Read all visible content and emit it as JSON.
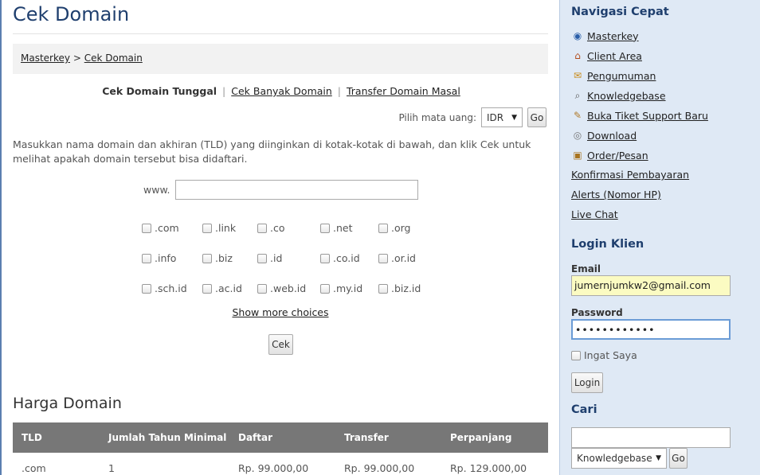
{
  "main": {
    "title": "Cek Domain",
    "breadcrumb": {
      "home": "Masterkey",
      "sep": ">",
      "current": "Cek Domain"
    },
    "modes": {
      "single": "Cek Domain Tunggal",
      "bulk": "Cek Banyak Domain",
      "transfer": "Transfer Domain Masal",
      "sep": "|"
    },
    "currency": {
      "label": "Pilih mata uang:",
      "value": "IDR",
      "go": "Go"
    },
    "intro": "Masukkan nama domain dan akhiran (TLD) yang diinginkan di kotak-kotak di bawah, dan klik Cek untuk melihat apakah domain tersebut bisa didaftari.",
    "www_label": "www.",
    "tlds": [
      ".com",
      ".link",
      ".co",
      ".net",
      ".org",
      ".info",
      ".biz",
      ".id",
      ".co.id",
      ".or.id",
      ".sch.id",
      ".ac.id",
      ".web.id",
      ".my.id",
      ".biz.id"
    ],
    "show_more": "Show more choices",
    "cek_button": "Cek",
    "pricing": {
      "title": "Harga Domain",
      "headers": [
        "TLD",
        "Jumlah Tahun Minimal",
        "Daftar",
        "Transfer",
        "Perpanjang"
      ],
      "rows": [
        [
          ".com",
          "1",
          "Rp. 99.000,00",
          "Rp. 99.000,00",
          "Rp. 129.000,00"
        ]
      ]
    }
  },
  "sidebar": {
    "nav_title": "Navigasi Cepat",
    "nav_items": [
      {
        "label": "Masterkey",
        "icon": "globe-icon",
        "glyph": "◉",
        "color": "#2a5ea8"
      },
      {
        "label": "Client Area",
        "icon": "home-icon",
        "glyph": "⌂",
        "color": "#b24a1a"
      },
      {
        "label": "Pengumuman",
        "icon": "announcement-icon",
        "glyph": "✉",
        "color": "#c98a17"
      },
      {
        "label": "Knowledgebase",
        "icon": "magnifier-icon",
        "glyph": "⌕",
        "color": "#555555"
      },
      {
        "label": "Buka Tiket Support Baru",
        "icon": "ticket-icon",
        "glyph": "✎",
        "color": "#b07a2a"
      },
      {
        "label": "Download",
        "icon": "disc-icon",
        "glyph": "◎",
        "color": "#777777"
      },
      {
        "label": "Order/Pesan",
        "icon": "box-icon",
        "glyph": "▣",
        "color": "#a8741f"
      },
      {
        "label": "Konfirmasi Pembayaran"
      },
      {
        "label": "Alerts (Nomor HP)"
      },
      {
        "label": "Live Chat"
      }
    ],
    "login_title": "Login Klien",
    "email_label": "Email",
    "email_value": "jumernjumkw2@gmail.com",
    "password_label": "Password",
    "password_value": "••••••••••••",
    "remember_label": "Ingat Saya",
    "login_button": "Login",
    "search_title": "Cari",
    "search_select": "Knowledgebase",
    "search_go": "Go"
  }
}
